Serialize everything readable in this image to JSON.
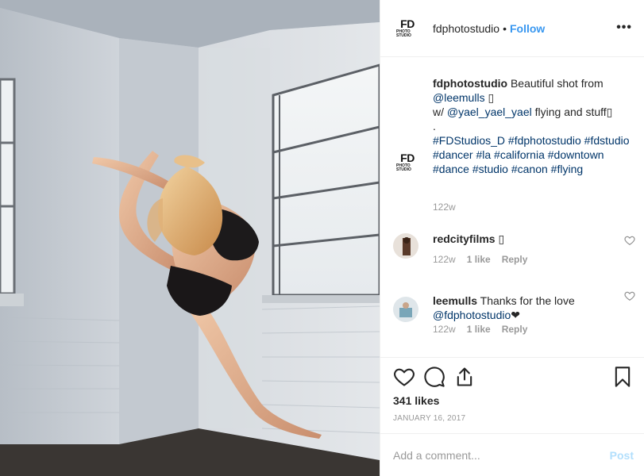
{
  "header": {
    "avatar_text": "FD",
    "avatar_sub": "PHOTO STUDIO",
    "username": "fdphotostudio",
    "separator": "•",
    "follow_label": "Follow",
    "more_label": "•••"
  },
  "caption": {
    "username": "fdphotostudio",
    "text_1": "Beautiful shot from",
    "mention_1": "@leemulls",
    "emoji_1": "▯",
    "text_2": "w/",
    "mention_2": "@yael_yael_yael",
    "text_3": "flying and stuff▯",
    "dot": ".",
    "hashtags": "#FDStudios_D #fdphotostudio #fdstudio #dancer #la #california #downtown #dance #studio #canon #flying",
    "time": "122w"
  },
  "comments": [
    {
      "username": "redcityfilms",
      "text": "▯",
      "time": "122w",
      "likes": "1 like",
      "reply": "Reply"
    },
    {
      "username": "leemulls",
      "text": "Thanks for the love",
      "mention": "@fdphotostudio",
      "emoji": "❤",
      "time": "122w",
      "likes": "1 like",
      "reply": "Reply"
    }
  ],
  "actions": {
    "icons": [
      "heart-icon",
      "comment-icon",
      "share-icon",
      "bookmark-icon"
    ],
    "likes": "341 likes",
    "date": "JANUARY 16, 2017"
  },
  "add_comment": {
    "placeholder": "Add a comment...",
    "post_label": "Post"
  },
  "colors": {
    "link_blue": "#3897f0",
    "mention_blue": "#003569",
    "meta_gray": "#999999",
    "post_disabled": "#b2dffc"
  }
}
